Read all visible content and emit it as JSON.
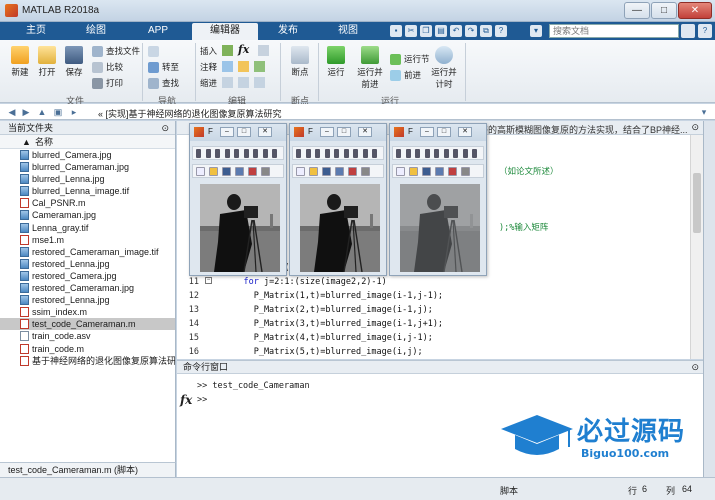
{
  "window": {
    "title": "MATLAB R2018a",
    "min": "—",
    "max": "□",
    "close": "✕"
  },
  "tabs": [
    "主页",
    "绘图",
    "APP",
    "编辑器",
    "发布",
    "视图"
  ],
  "search": {
    "placeholder": "搜索文档"
  },
  "help": "?",
  "toolstrip": {
    "file": {
      "label": "文件",
      "new": "新建",
      "open": "打开",
      "save": "保存",
      "find_files": "查找文件",
      "compare": "比较",
      "print": "打印"
    },
    "navigate": {
      "label": "导航",
      "goto": "转至",
      "find": "查找"
    },
    "edit": {
      "label": "编辑",
      "insert": "插入",
      "comment": "注释",
      "indent": "缩进",
      "fx": "fx"
    },
    "breakpoints": {
      "label": "断点",
      "button": "断点"
    },
    "run": {
      "label": "运行",
      "run": "运行",
      "run_advance": "运行并前进",
      "run_section": "运行节",
      "advance": "前进",
      "run_time": "运行并计时"
    }
  },
  "address": {
    "path": "« [实现]基于神经网络的退化图像复原算法研究"
  },
  "current_folder": {
    "title": "当前文件夹",
    "column": "名称",
    "files": [
      {
        "name": "blurred_Camera.jpg",
        "type": "img"
      },
      {
        "name": "blurred_Cameraman.jpg",
        "type": "img"
      },
      {
        "name": "blurred_Lenna.jpg",
        "type": "img"
      },
      {
        "name": "blurred_Lenna_image.tif",
        "type": "img"
      },
      {
        "name": "Cal_PSNR.m",
        "type": "m"
      },
      {
        "name": "Cameraman.jpg",
        "type": "img"
      },
      {
        "name": "Lenna_gray.tif",
        "type": "img"
      },
      {
        "name": "mse1.m",
        "type": "m"
      },
      {
        "name": "restored_Cameraman_image.tif",
        "type": "img"
      },
      {
        "name": "restored_Lenna.jpg",
        "type": "img"
      },
      {
        "name": "restored_Camera.jpg",
        "type": "img"
      },
      {
        "name": "restored_Cameraman.jpg",
        "type": "img"
      },
      {
        "name": "restored_Lenna.jpg",
        "type": "img"
      },
      {
        "name": "ssim_index.m",
        "type": "m"
      },
      {
        "name": "test_code_Cameraman.m",
        "type": "m",
        "selected": true
      },
      {
        "name": "train_code.asv",
        "type": "other"
      },
      {
        "name": "train_code.m",
        "type": "m"
      },
      {
        "name": "基于神经网络的退化图像复原算法研...",
        "type": "m"
      }
    ],
    "details": "test_code_Cameraman.m  (脚本)"
  },
  "editor": {
    "header_text": "络的高斯模糊图像复原的方法实现，结合了BP神经...",
    "lines": [
      {
        "num": "",
        "code": "",
        "cls": ""
      },
      {
        "num": "",
        "code": "",
        "cls": ""
      },
      {
        "num": "",
        "code": "（如论文所述）",
        "cls": "cm"
      },
      {
        "num": "",
        "code": "",
        "cls": ""
      },
      {
        "num": "",
        "code": "",
        "cls": ""
      },
      {
        "num": "",
        "code": "",
        "cls": ""
      },
      {
        "num": "",
        "code": ");%输入矩阵",
        "cls": "cm"
      },
      {
        "num": "",
        "code": "",
        "cls": ""
      },
      {
        "num": "",
        "code": "",
        "cls": ""
      },
      {
        "num": "10",
        "code": "  for i=2:1:(size(image2,1)-1)",
        "cls": ""
      },
      {
        "num": "11",
        "code": "    for j=2:1:(size(image2,2)-1)",
        "cls": ""
      },
      {
        "num": "12",
        "code": "      P_Matrix(1,t)=blurred_image(i-1,j-1);",
        "cls": ""
      },
      {
        "num": "13",
        "code": "      P_Matrix(2,t)=blurred_image(i-1,j);",
        "cls": ""
      },
      {
        "num": "14",
        "code": "      P_Matrix(3,t)=blurred_image(i-1,j+1);",
        "cls": ""
      },
      {
        "num": "15",
        "code": "      P_Matrix(4,t)=blurred_image(i,j-1);",
        "cls": ""
      },
      {
        "num": "16",
        "code": "      P_Matrix(5,t)=blurred_image(i,j);",
        "cls": ""
      }
    ]
  },
  "figures": [
    {
      "label": "F"
    },
    {
      "label": "F"
    },
    {
      "label": "F"
    }
  ],
  "command_window": {
    "title": "命令行窗口",
    "history": ">> test_code_Cameraman",
    "prompt": ">>",
    "fx": "fx"
  },
  "status": {
    "script": "脚本",
    "row_label": "行",
    "row": "6",
    "col_label": "列",
    "col": "64"
  },
  "watermark": {
    "cn": "必过源码",
    "en": "Biguo100.com"
  },
  "colors": {
    "tabstrip": "#1f5a94",
    "keyword": "#1a20c8",
    "comment": "#1e8a3c",
    "watermark": "#1f7fd0"
  }
}
